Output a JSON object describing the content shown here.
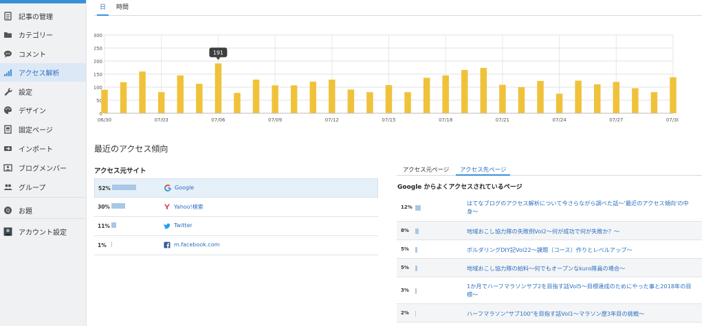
{
  "sidebar": {
    "items": [
      {
        "label": "記事の管理",
        "icon": "document-icon"
      },
      {
        "label": "カテゴリー",
        "icon": "folder-icon"
      },
      {
        "label": "コメント",
        "icon": "comment-icon"
      },
      {
        "label": "アクセス解析",
        "icon": "bar-chart-icon",
        "active": true
      },
      {
        "label": "設定",
        "icon": "wrench-icon"
      },
      {
        "label": "デザイン",
        "icon": "palette-icon"
      },
      {
        "label": "固定ページ",
        "icon": "page-icon"
      },
      {
        "label": "インポート",
        "icon": "import-icon"
      },
      {
        "label": "ブログメンバー",
        "icon": "members-icon"
      },
      {
        "label": "グループ",
        "icon": "group-icon"
      },
      {
        "label": "お題",
        "icon": "odai-icon"
      },
      {
        "label": "アカウント設定",
        "icon": "avatar-icon"
      }
    ]
  },
  "tabs": {
    "day": "日",
    "hour": "時間"
  },
  "colors": {
    "accent": "#3a8fd8",
    "bar": "#f0c23b",
    "link": "#2a6fc0"
  },
  "chart_data": {
    "type": "bar",
    "title": "",
    "ylim": [
      0,
      300
    ],
    "yticks": [
      "0",
      "50",
      "100",
      "150",
      "200",
      "250",
      "300"
    ],
    "categories": [
      "06/30",
      "07/01",
      "07/02",
      "07/03",
      "07/04",
      "07/05",
      "07/06",
      "07/07",
      "07/08",
      "07/09",
      "07/10",
      "07/11",
      "07/12",
      "07/13",
      "07/14",
      "07/15",
      "07/16",
      "07/17",
      "07/18",
      "07/19",
      "07/20",
      "07/21",
      "07/22",
      "07/23",
      "07/24",
      "07/25",
      "07/26",
      "07/27",
      "07/28",
      "07/29",
      "07/30"
    ],
    "xtick_labels": [
      "06/30",
      "07/03",
      "07/06",
      "07/09",
      "07/12",
      "07/15",
      "07/18",
      "07/21",
      "07/24",
      "07/27",
      "07/30"
    ],
    "values": [
      90,
      119,
      160,
      81,
      145,
      113,
      191,
      78,
      129,
      107,
      107,
      121,
      129,
      91,
      81,
      108,
      81,
      136,
      145,
      166,
      174,
      109,
      100,
      124,
      75,
      125,
      111,
      120,
      96,
      81,
      138
    ],
    "tooltip": {
      "category": "07/06",
      "value": "191"
    },
    "grid": true
  },
  "recent": {
    "title": "最近のアクセス傾向"
  },
  "sources": {
    "heading": "アクセス元サイト",
    "rows": [
      {
        "pct": "52%",
        "value": 0.52,
        "name": "Google",
        "icon": "google-icon"
      },
      {
        "pct": "30%",
        "value": 0.3,
        "name": "Yahoo!検索",
        "icon": "yahoo-icon"
      },
      {
        "pct": "11%",
        "value": 0.11,
        "name": "Twitter",
        "icon": "twitter-icon"
      },
      {
        "pct": "1%",
        "value": 0.01,
        "name": "m.facebook.com",
        "icon": "facebook-icon"
      }
    ]
  },
  "pages": {
    "tab_source": "アクセス元ページ",
    "tab_target": "アクセス先ページ",
    "heading": "Google からよくアクセスされているページ",
    "rows": [
      {
        "pct": "12%",
        "value": 0.12,
        "title": "はてなブログのアクセス解析について今さらながら調べた話〜'最近のアクセス傾向'の中身〜"
      },
      {
        "pct": "8%",
        "value": 0.08,
        "title": "地域おこし協力隊の失敗例Vol2〜何が成功で何が失敗か？〜"
      },
      {
        "pct": "5%",
        "value": 0.05,
        "title": "ボルダリングDIY記Vol22〜課題（コース）作りとレベルアップ〜"
      },
      {
        "pct": "5%",
        "value": 0.05,
        "title": "地域おこし協力隊の給料〜何でもオープンなkuro隊員の場合〜"
      },
      {
        "pct": "3%",
        "value": 0.03,
        "title": "1か月でハーフマラソンサブ2を目指す話Vol5〜目標達成のためにやった事と2018年の目標〜"
      },
      {
        "pct": "2%",
        "value": 0.02,
        "title": "ハーフマラソン\"サブ100\"を目指す話Vol1〜マラソン歴3年目の挑戦〜"
      }
    ]
  }
}
